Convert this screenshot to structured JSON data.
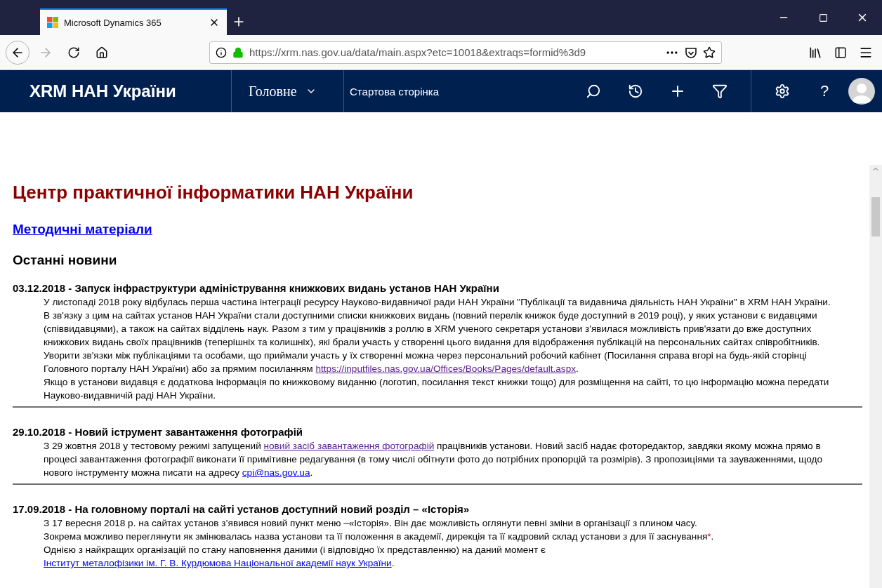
{
  "browser": {
    "tab_title": "Microsoft Dynamics 365",
    "url": "https://xrm.nas.gov.ua/data/main.aspx?etc=10018&extraqs=formid%3d9",
    "forward_disabled": true
  },
  "app_header": {
    "brand": "XRM НАН України",
    "area": "Головне",
    "page": "Стартова сторінка",
    "help": "?"
  },
  "title": "Центр практичної інформатики НАН України",
  "materials_link": "Методичні матеріали",
  "news_heading": "Останні новини",
  "news": [
    {
      "headline": "03.12.2018 - Запуск інфраструктури адміністрування книжкових видань установ НАН України",
      "paragraphs": [
        [
          {
            "kind": "text",
            "text": "У листопаді 2018 року відбулась перша частина інтеграції ресурсу Науково-видавничої ради НАН України \"Публікації та видавнича діяльність НАН України\" в XRM НАН України. В зв'язку з цим на сайтах установ НАН України стали доступними списки книжкових видань (повний перелік книжок буде доступний в 2019 році), у яких установи є видавцями (співвидавцями), а також на сайтах відділень наук. Разом з тим у працівників з роллю в XRM ученого секретаря установи з'явилася можливість прив'язати до вже доступних книжкових видань своїх працівників (теперішніх та колишніх), які брали участь у створенні цього видання для відображення публікацій на персональних сайтах співробітників. Уворити зв'язки між публікаціями та особами, що приймали участь у їх створенні можна через персональний робочий кабінет (Посилання справа вгорі на будь-якій сторінці Головного порталу НАН України) або за прямим посиланням "
          },
          {
            "kind": "link",
            "visited": true,
            "text": "https://inputfiles.nas.gov.ua/Offices/Books/Pages/default.aspx"
          },
          {
            "kind": "text",
            "text": "."
          }
        ],
        [
          {
            "kind": "text",
            "text": "Якщо в установи видавця є додаткова інформація по книжковому виданню (логотип, посилання текст книжки тощо) для розміщення на сайті, то цю інформацію можна передати Науково-видавничій раді НАН України."
          }
        ]
      ]
    },
    {
      "headline": "29.10.2018 - Новий іструмент завантаження фотографій",
      "paragraphs": [
        [
          {
            "kind": "text",
            "text": "З 29 жовтня 2018 у тестовому режимі запущений "
          },
          {
            "kind": "link",
            "visited": true,
            "text": "новий засіб завантаження фотографій"
          },
          {
            "kind": "text",
            "text": " працівників установи. Новий засіб надає фоторедактор, завдяки якому можна прямо в процесі завантаження фотографії виконати її примітивне редагування (в тому числі обітнути фото до потрібних пропорцій та розмірів). З пропозиціями та зауваженнями, щодо нового інструменту можна писати на адресу "
          },
          {
            "kind": "link",
            "visited": false,
            "text": "cpi@nas.gov.ua"
          },
          {
            "kind": "text",
            "text": "."
          }
        ]
      ]
    },
    {
      "headline": "17.09.2018 - На головному порталі на сайті установ доступний новий розділ – «Історія»",
      "paragraphs": [
        [
          {
            "kind": "text",
            "text": "З 17 вересня 2018 р. на сайтах установ з’явився новий пункт меню –«Історія». Він дає можливість оглянути певні зміни в організації з плином часу."
          }
        ],
        [
          {
            "kind": "text",
            "text": "Зокрема можливо переглянути як змінювалась назва установи та її положення в академії, дирекція та її кадровий склад установи з для її заснування"
          },
          {
            "kind": "mark",
            "text": "*"
          },
          {
            "kind": "text",
            "text": "."
          }
        ],
        [
          {
            "kind": "text",
            "text": "Однією з найкращих організацій по стану наповнення даними  (і відповідно їх представленню)  на даний момент є "
          },
          {
            "kind": "link",
            "visited": false,
            "text": "Інститут металофізики ім. Г. В. Курдюмова Національної академії наук України"
          },
          {
            "kind": "text",
            "text": "."
          }
        ]
      ]
    }
  ]
}
